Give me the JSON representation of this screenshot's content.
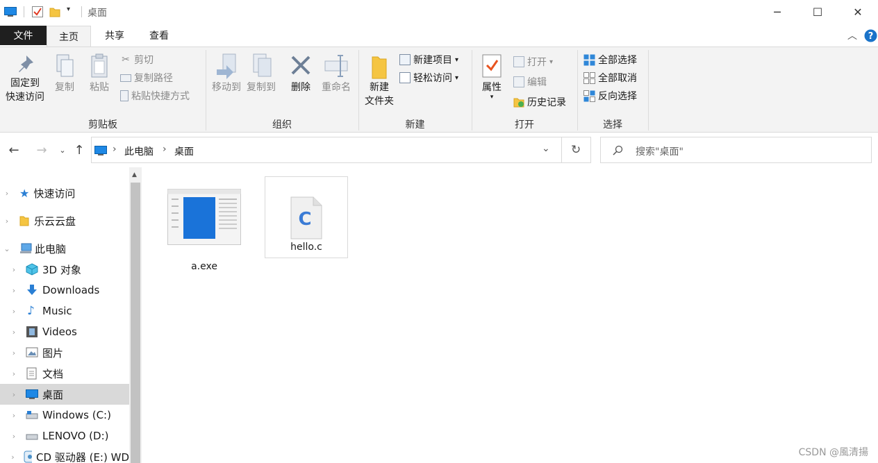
{
  "window": {
    "title": "桌面",
    "controls": {
      "minimize": "─",
      "maximize": "☐",
      "close": "✕"
    }
  },
  "tabs": {
    "file": "文件",
    "home": "主页",
    "share": "共享",
    "view": "查看"
  },
  "ribbon": {
    "clipboard": {
      "group": "剪贴板",
      "pin_line1": "固定到",
      "pin_line2": "快速访问",
      "copy": "复制",
      "paste": "粘贴",
      "cut": "剪切",
      "copy_path": "复制路径",
      "paste_shortcut": "粘贴快捷方式"
    },
    "organize": {
      "group": "组织",
      "move_to": "移动到",
      "copy_to": "复制到",
      "delete": "删除",
      "rename": "重命名"
    },
    "new": {
      "group": "新建",
      "new_folder_line1": "新建",
      "new_folder_line2": "文件夹",
      "new_item": "新建项目",
      "easy_access": "轻松访问"
    },
    "open": {
      "group": "打开",
      "properties": "属性",
      "open": "打开",
      "edit": "编辑",
      "history": "历史记录"
    },
    "select": {
      "group": "选择",
      "select_all": "全部选择",
      "select_none": "全部取消",
      "invert": "反向选择"
    }
  },
  "address": {
    "crumbs": [
      "此电脑",
      "桌面"
    ],
    "search_placeholder": "搜索\"桌面\""
  },
  "nav": {
    "items": [
      {
        "label": "快速访问",
        "icon": "star-icon"
      },
      {
        "label": "乐云云盘",
        "icon": "folder-icon"
      },
      {
        "label": "此电脑",
        "icon": "computer-icon"
      },
      {
        "label": "3D 对象",
        "icon": "cube-icon"
      },
      {
        "label": "Downloads",
        "icon": "download-icon"
      },
      {
        "label": "Music",
        "icon": "music-icon"
      },
      {
        "label": "Videos",
        "icon": "film-icon"
      },
      {
        "label": "图片",
        "icon": "picture-icon"
      },
      {
        "label": "文档",
        "icon": "document-icon"
      },
      {
        "label": "桌面",
        "icon": "desktop-icon"
      },
      {
        "label": "Windows (C:)",
        "icon": "drive-icon"
      },
      {
        "label": "LENOVO (D:)",
        "icon": "drive-icon"
      },
      {
        "label": "CD 驱动器 (E:) WD",
        "icon": "cd-drive-icon"
      }
    ]
  },
  "files": [
    {
      "name": "a.exe",
      "icon": "exe-thumbnail"
    },
    {
      "name": "hello.c",
      "icon": "c-file-icon"
    }
  ],
  "watermark": "CSDN @風清揚",
  "colors": {
    "accent": "#0078d7",
    "help": "#1a73c9",
    "selected_nav": "#d9d9d9"
  }
}
